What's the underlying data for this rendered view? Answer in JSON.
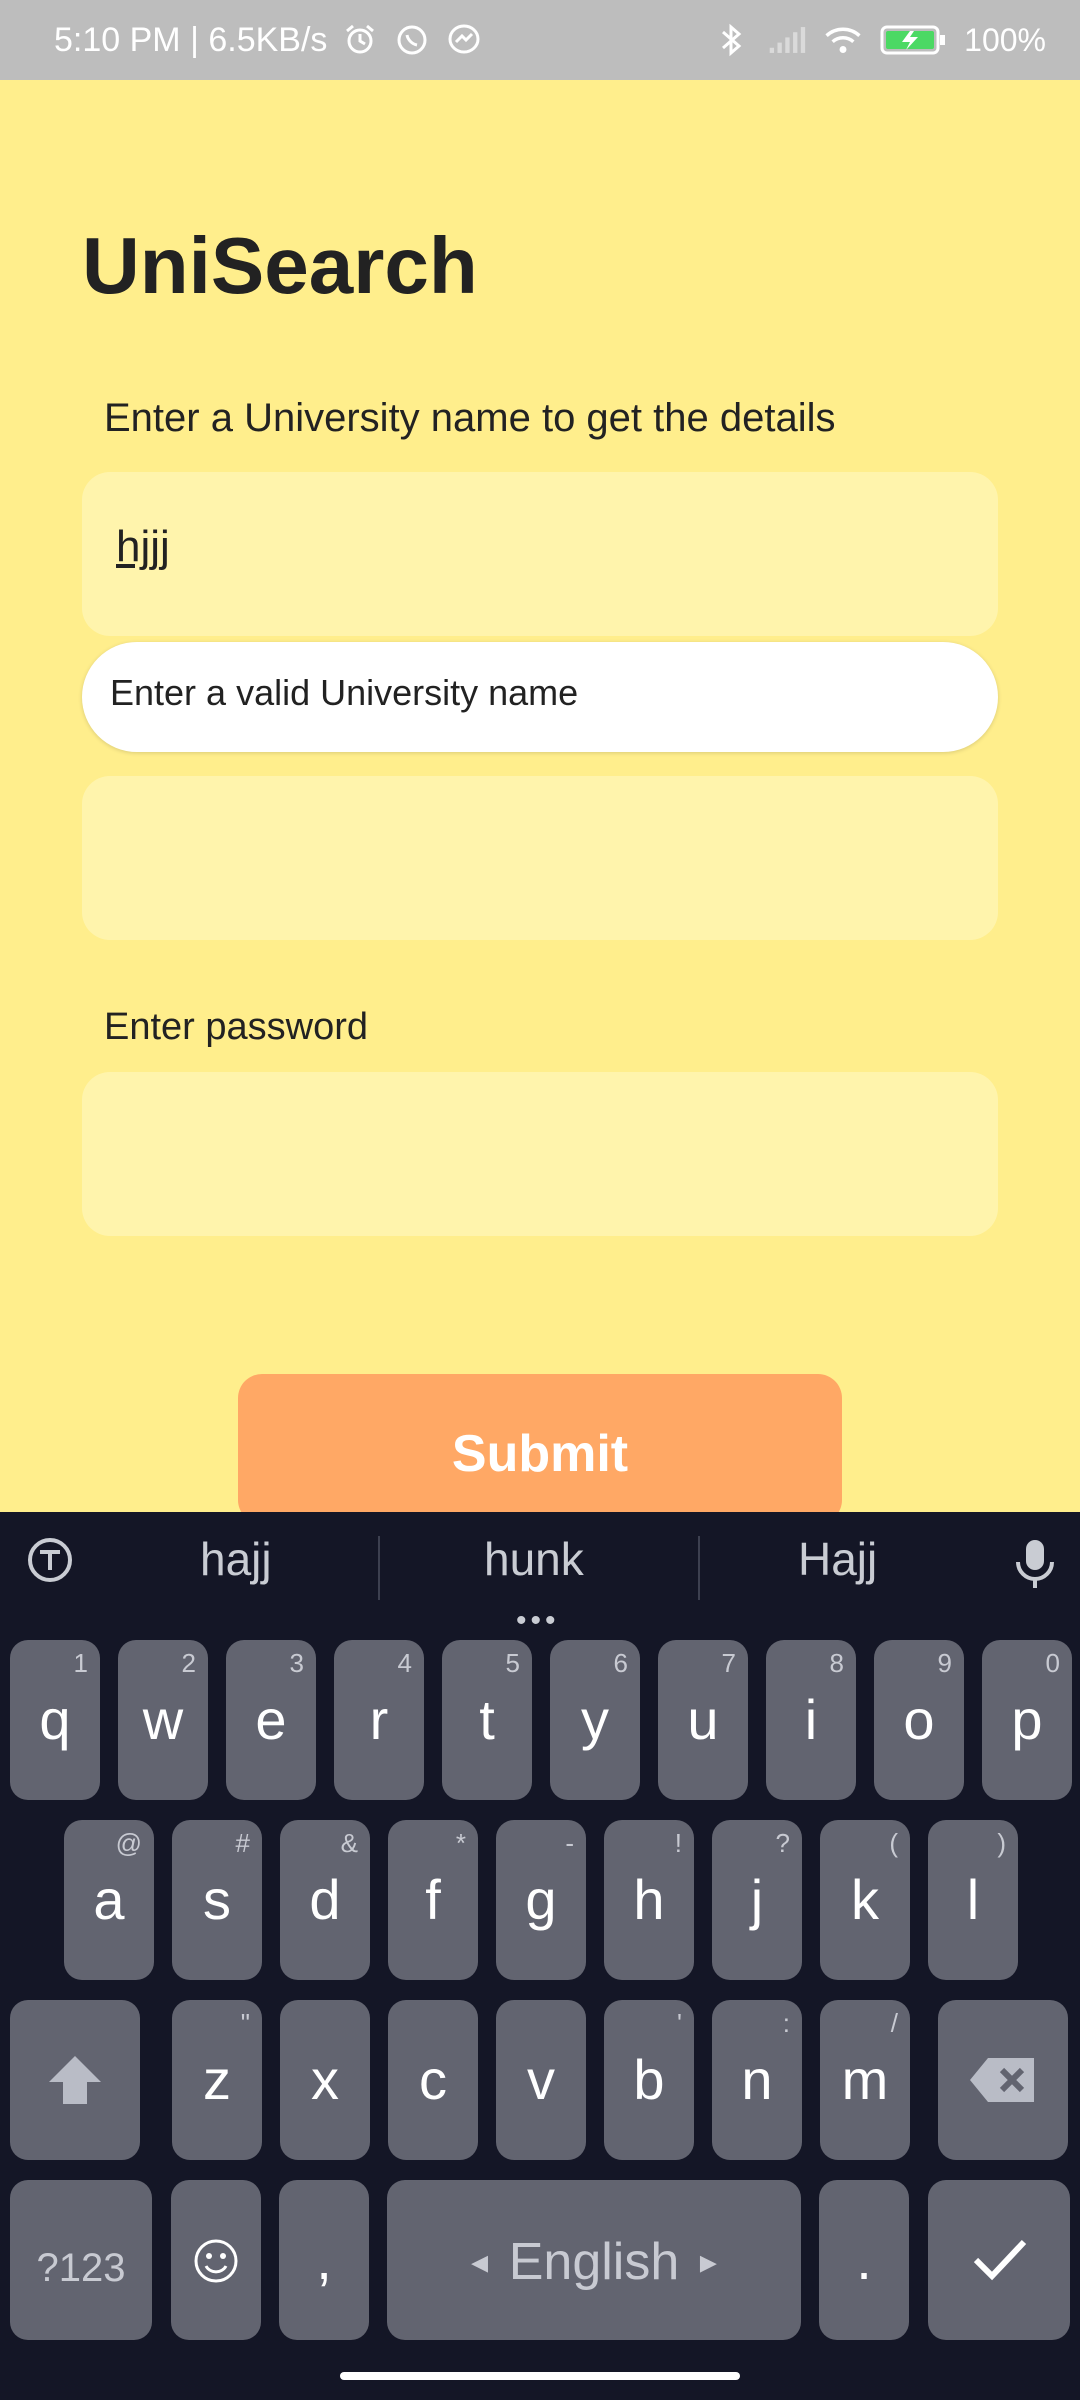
{
  "status_bar": {
    "time_speed": "5:10 PM | 6.5KB/s",
    "battery": "100%",
    "icons": [
      "alarm-icon",
      "whatsapp-icon",
      "messenger-icon",
      "bluetooth-icon",
      "signal-icon",
      "wifi-icon",
      "battery-charging-icon"
    ]
  },
  "app": {
    "title": "UniSearch",
    "label_university": "Enter a University name to get the details",
    "university_value": "hjjj",
    "error_tooltip": "Enter a valid University name",
    "label_password": "Enter password",
    "submit_label": "Submit"
  },
  "keyboard": {
    "suggestions": [
      "hajj",
      "hunk",
      "Hajj"
    ],
    "row1": [
      {
        "k": "q",
        "h": "1"
      },
      {
        "k": "w",
        "h": "2"
      },
      {
        "k": "e",
        "h": "3"
      },
      {
        "k": "r",
        "h": "4"
      },
      {
        "k": "t",
        "h": "5"
      },
      {
        "k": "y",
        "h": "6"
      },
      {
        "k": "u",
        "h": "7"
      },
      {
        "k": "i",
        "h": "8"
      },
      {
        "k": "o",
        "h": "9"
      },
      {
        "k": "p",
        "h": "0"
      }
    ],
    "row2": [
      {
        "k": "a",
        "h": "@"
      },
      {
        "k": "s",
        "h": "#"
      },
      {
        "k": "d",
        "h": "&"
      },
      {
        "k": "f",
        "h": "*"
      },
      {
        "k": "g",
        "h": "-"
      },
      {
        "k": "h",
        "h": "!"
      },
      {
        "k": "j",
        "h": "?"
      },
      {
        "k": "k",
        "h": "("
      },
      {
        "k": "l",
        "h": ")"
      }
    ],
    "row3": [
      {
        "k": "z",
        "h": "\""
      },
      {
        "k": "x",
        "h": ""
      },
      {
        "k": "c",
        "h": ""
      },
      {
        "k": "v",
        "h": ""
      },
      {
        "k": "b",
        "h": "'"
      },
      {
        "k": "n",
        "h": ":"
      },
      {
        "k": "m",
        "h": "/"
      }
    ],
    "symbols_label": "?123",
    "comma": ",",
    "space_label": "English",
    "period": "."
  }
}
